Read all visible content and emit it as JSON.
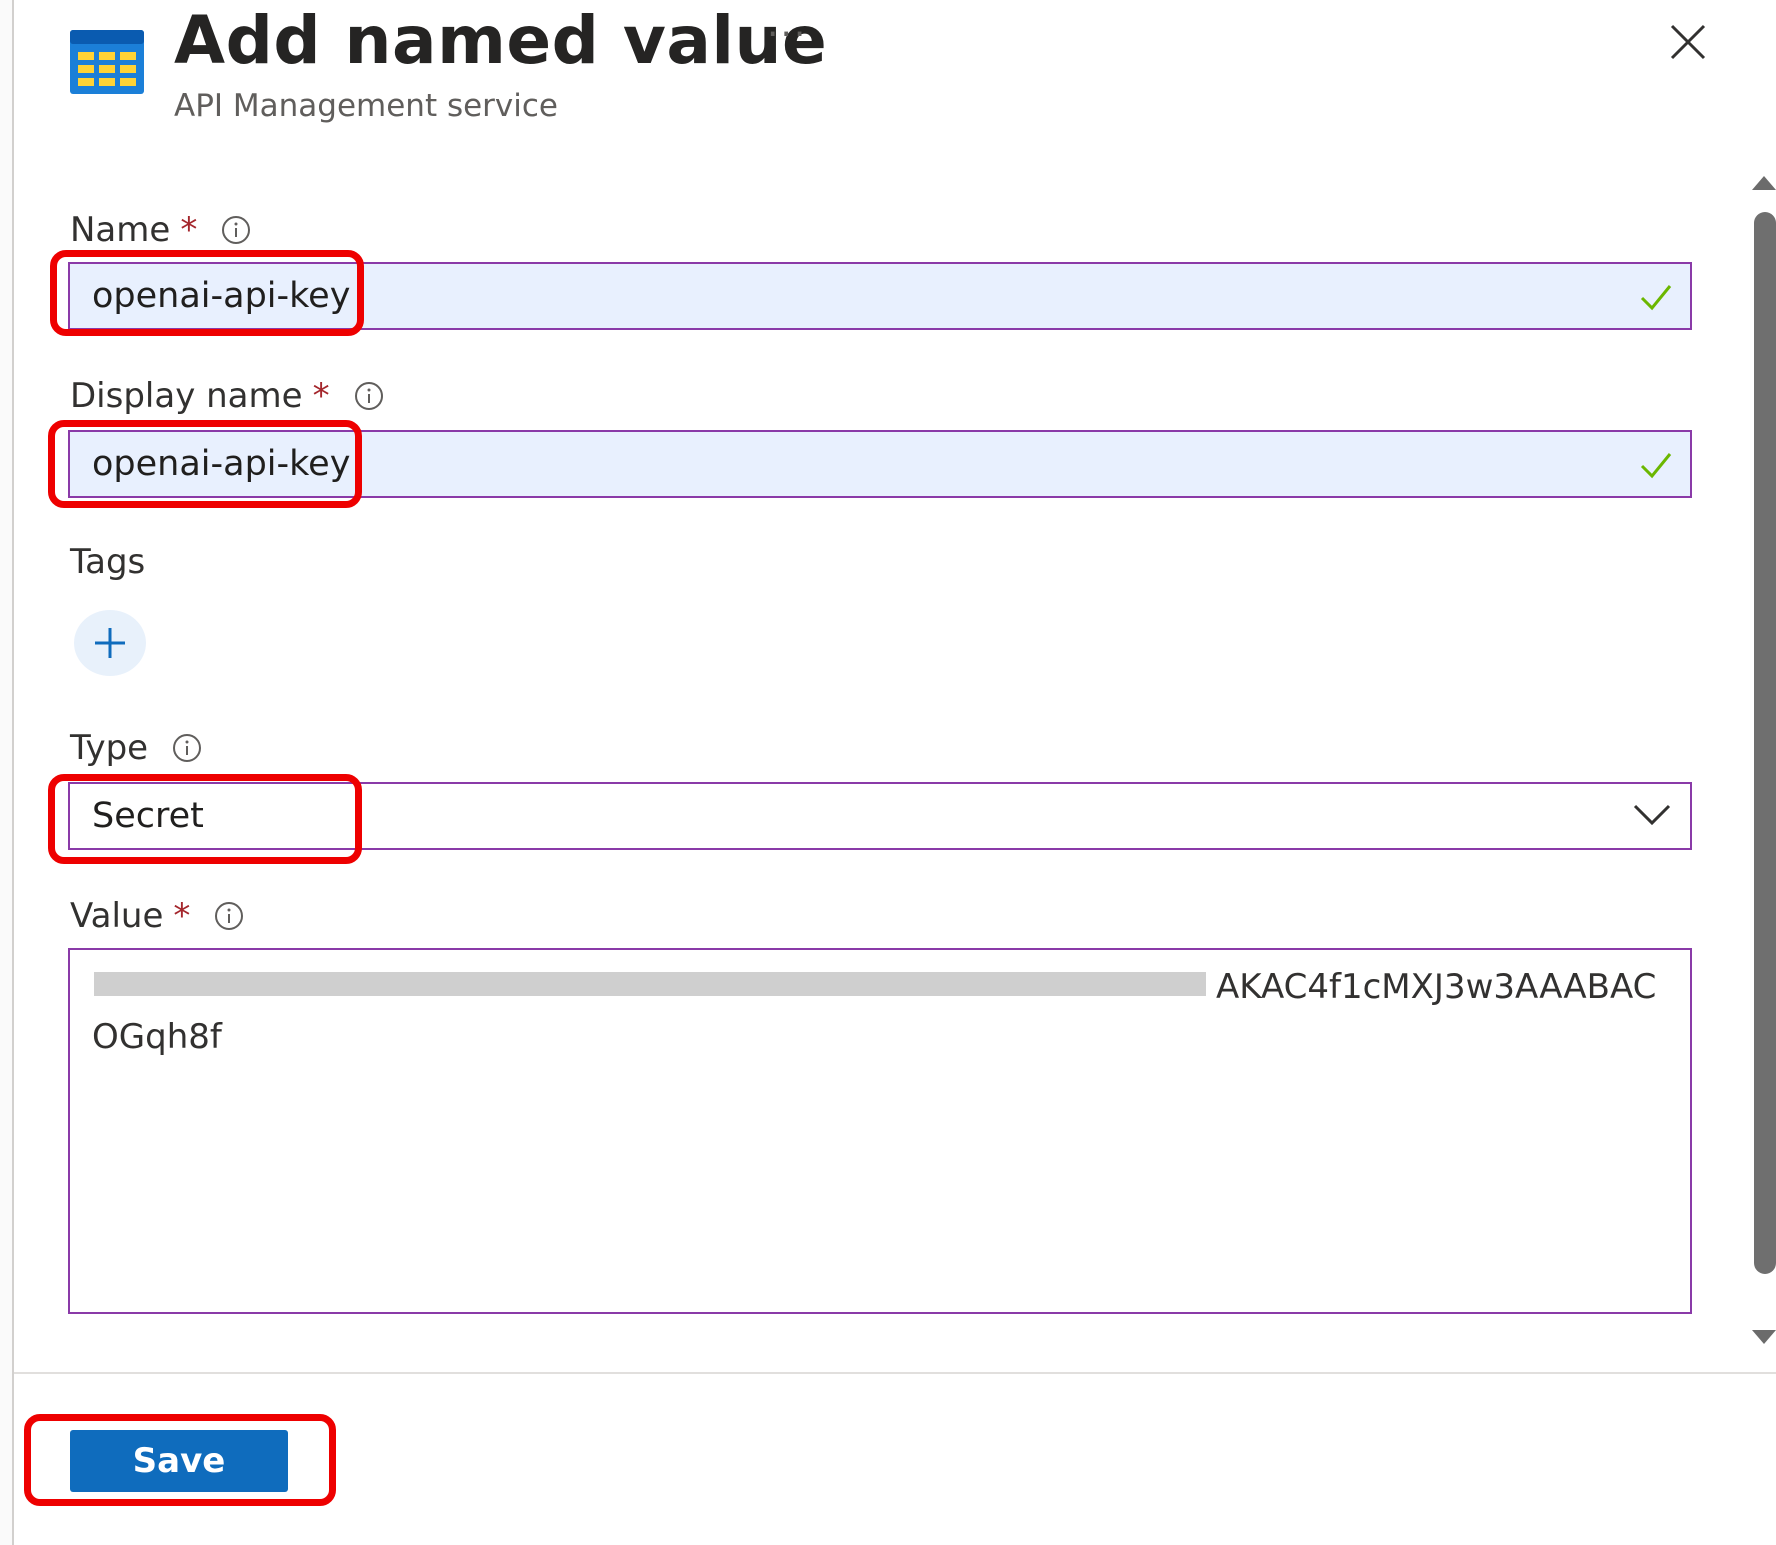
{
  "header": {
    "title": "Add named value",
    "subtitle": "API Management service",
    "more_label": "···"
  },
  "form": {
    "name": {
      "label": "Name",
      "required_mark": "*",
      "value": "openai-api-key"
    },
    "display_name": {
      "label": "Display name",
      "required_mark": "*",
      "value": "openai-api-key"
    },
    "tags": {
      "label": "Tags"
    },
    "type": {
      "label": "Type",
      "selected": "Secret"
    },
    "value": {
      "label": "Value",
      "required_mark": "*",
      "visible_text": "AKAC4f1cMXJ3w3AAABAC",
      "visible_text_line2": "OGqh8f"
    }
  },
  "footer": {
    "save_label": "Save"
  },
  "colors": {
    "accent": "#0f6cbd",
    "field_border": "#8a3aa8",
    "autofill_bg": "#e8f0fe",
    "highlight": "#ee0000",
    "required": "#a4262c",
    "valid_check": "#6bb700"
  }
}
